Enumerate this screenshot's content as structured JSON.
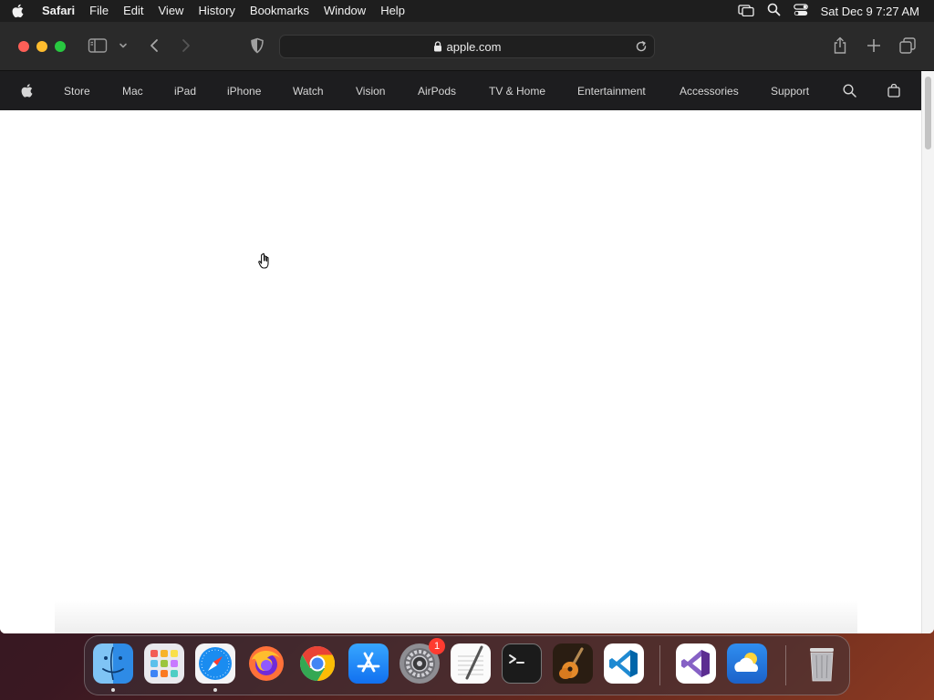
{
  "menubar": {
    "app_name": "Safari",
    "items": [
      "File",
      "Edit",
      "View",
      "History",
      "Bookmarks",
      "Window",
      "Help"
    ],
    "clock": "Sat Dec 9  7:27 AM",
    "status_icons": [
      "screen-mirroring-icon",
      "spotlight-search-icon",
      "control-center-icon"
    ]
  },
  "toolbar": {
    "url": "apple.com",
    "secure": true
  },
  "globalnav": {
    "links": [
      "Store",
      "Mac",
      "iPad",
      "iPhone",
      "Watch",
      "Vision",
      "AirPods",
      "TV & Home",
      "Entertainment",
      "Accessories",
      "Support"
    ]
  },
  "dock": {
    "apps": [
      {
        "name": "Finder",
        "icon": "finder-icon",
        "running": true
      },
      {
        "name": "Launchpad",
        "icon": "launchpad-icon",
        "running": false
      },
      {
        "name": "Safari",
        "icon": "safari-icon",
        "running": true
      },
      {
        "name": "Firefox",
        "icon": "firefox-icon",
        "running": false
      },
      {
        "name": "Google Chrome",
        "icon": "chrome-icon",
        "running": false
      },
      {
        "name": "App Store",
        "icon": "app-store-icon",
        "running": false
      },
      {
        "name": "System Settings",
        "icon": "system-settings-icon",
        "running": false,
        "badge": "1"
      },
      {
        "name": "TextEdit",
        "icon": "textedit-icon",
        "running": false
      },
      {
        "name": "Terminal",
        "icon": "terminal-icon",
        "running": false
      },
      {
        "name": "GarageBand",
        "icon": "garageband-icon",
        "running": false
      },
      {
        "name": "Visual Studio Code",
        "icon": "vscode-icon",
        "running": false
      },
      {
        "name": "Visual Studio",
        "icon": "visual-studio-icon",
        "running": false
      },
      {
        "name": "Weather",
        "icon": "weather-icon",
        "running": false
      },
      {
        "name": "Trash",
        "icon": "trash-icon",
        "running": false
      }
    ]
  },
  "colors": {
    "nav_bg": "#1d1d1f",
    "toolbar_bg": "#2a2a2a",
    "close": "#fe5f57",
    "minimize": "#febc2e",
    "zoom": "#28c840",
    "badge": "#ff3b30"
  }
}
